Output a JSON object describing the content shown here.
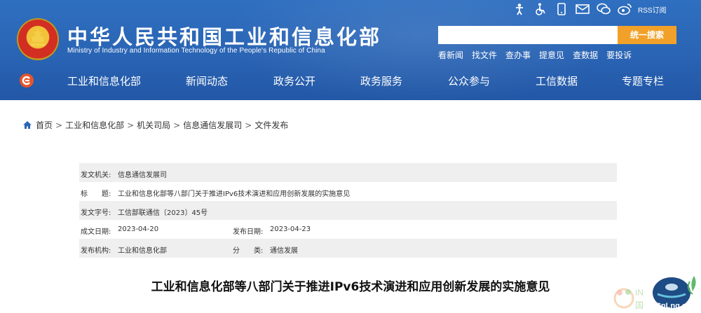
{
  "header": {
    "title": "中华人民共和国工业和信息化部",
    "subtitle": "Ministry of Industry and Information Technology of the People's Republic of China",
    "top_icons": [
      "accessibility-person-icon",
      "wheelchair-icon",
      "mobile-phone-icon",
      "mail-icon",
      "wechat-icon",
      "weibo-icon"
    ],
    "rss_label": "RSS订阅",
    "search": {
      "placeholder": "",
      "button_label": "统一搜索"
    },
    "quick_links": [
      "看新闻",
      "找文件",
      "查办事",
      "提意见",
      "查数据",
      "要投诉"
    ]
  },
  "nav": {
    "items": [
      "工业和信息化部",
      "新闻动态",
      "政务公开",
      "政务服务",
      "公众参与",
      "工信数据",
      "专题专栏"
    ]
  },
  "breadcrumb": [
    "首页",
    "工业和信息化部",
    "机关司局",
    "信息通信发展司",
    "文件发布"
  ],
  "info": {
    "issuer_label": "发文机关:",
    "issuer": "信息通信发展司",
    "title_label": "标　　题:",
    "title": "工业和信息化部等八部门关于推进IPv6技术演进和应用创新发展的实施意见",
    "doc_no_label": "发文字号:",
    "doc_no": "工信部联通信〔2023〕45号",
    "created_label": "成文日期:",
    "created": "2023-04-20",
    "published_label": "发布日期:",
    "published": "2023-04-23",
    "org_label": "发布机构:",
    "org": "工业和信息化部",
    "category_label": "分　　类:",
    "category": "通信发展"
  },
  "document_title": "工业和信息化部等八部门关于推进IPv6技术演进和应用创新发展的实施意见",
  "watermark_text": "CnLng.com",
  "colors": {
    "header_blue": "#2a64b4",
    "search_orange": "#f1a12a",
    "row_shade": "#efefef"
  }
}
